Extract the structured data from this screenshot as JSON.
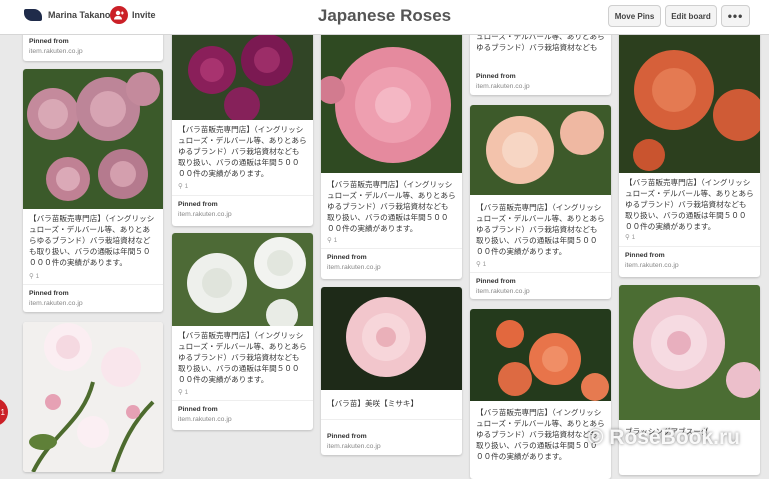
{
  "header": {
    "user_name": "Marina Takano",
    "invite_icon": "person-plus-icon",
    "invite_label": "Invite",
    "board_title": "Japanese Roses",
    "move_pins_label": "Move Pins",
    "edit_board_label": "Edit board",
    "more_label": "•••"
  },
  "notification": {
    "count": "1"
  },
  "pins": [
    {
      "src_label": "Pinned from",
      "src_url": "item.rakuten.co.jp"
    },
    {
      "desc": "【バラ苗販売専門店】（イングリッシュローズ・デルバール等、ありとあらゆるブランド）バラ栽培資材なども取り扱い、バラの通販は年間５００００件の実績があります。",
      "meta": "1",
      "src_label": "Pinned from",
      "src_url": "item.rakuten.co.jp"
    },
    {
      "image_icon": "white-pink-rose-photo"
    },
    {
      "desc": "【バラ苗販売専門店】（イングリッシュローズ・デルバール等、ありとあらゆるブランド）バラ栽培資材なども取り扱い、バラの通販は年間５００００件の実績があります。",
      "meta": "1",
      "src_label": "Pinned from",
      "src_url": "item.rakuten.co.jp"
    },
    {
      "desc": "【バラ苗販売専門店】（イングリッシュローズ・デルバール等、ありとあらゆるブランド）バラ栽培資材なども取り扱い、バラの通販は年間５００００件の実績があります。",
      "meta": "1",
      "src_label": "Pinned from",
      "src_url": "item.rakuten.co.jp"
    },
    {
      "desc": "【バラ苗販売専門店】（イングリッシュローズ・デルバール等、ありとあらゆるブランド）バラ栽培資材なども取り扱い、バラの通販は年間５００００件の実績があります。",
      "meta": "1",
      "src_label": "Pinned from",
      "src_url": "item.rakuten.co.jp"
    },
    {
      "desc": "【バラ苗】美咲【ミサキ】",
      "src_label": "Pinned from",
      "src_url": "item.rakuten.co.jp"
    },
    {
      "desc": "【バラ苗販売専門店】（イングリッシュローズ・デルバール等、ありとあらゆるブランド）バラ栽培資材なども取り扱い、バラの通販は年間５００００件の実績があります。",
      "src_label": "Pinned from",
      "src_url": "item.rakuten.co.jp"
    },
    {
      "desc": "【バラ苗販売専門店】（イングリッシュローズ・デルバール等、ありとあらゆるブランド）バラ栽培資材なども取り扱い、バラの通販は年間５００００件の実績があります。",
      "meta": "1",
      "src_label": "Pinned from",
      "src_url": "item.rakuten.co.jp"
    },
    {
      "desc": "【バラ苗販売専門店】（イングリッシュローズ・デルバール等、ありとあらゆるブランド）バラ栽培資材なども取り扱い、バラの通販は年間５００００件の実績があります。"
    },
    {
      "desc": "【バラ苗販売専門店】（イングリッシュローズ・デルバール等、ありとあらゆるブランド）バラ栽培資材なども取り扱い、バラの通販は年間５００００件の実績があります。",
      "meta": "1",
      "src_label": "Pinned from",
      "src_url": "item.rakuten.co.jp"
    },
    {
      "desc": "ブラッシングアブスーダ"
    }
  ],
  "watermark": "© RoseBook.ru"
}
